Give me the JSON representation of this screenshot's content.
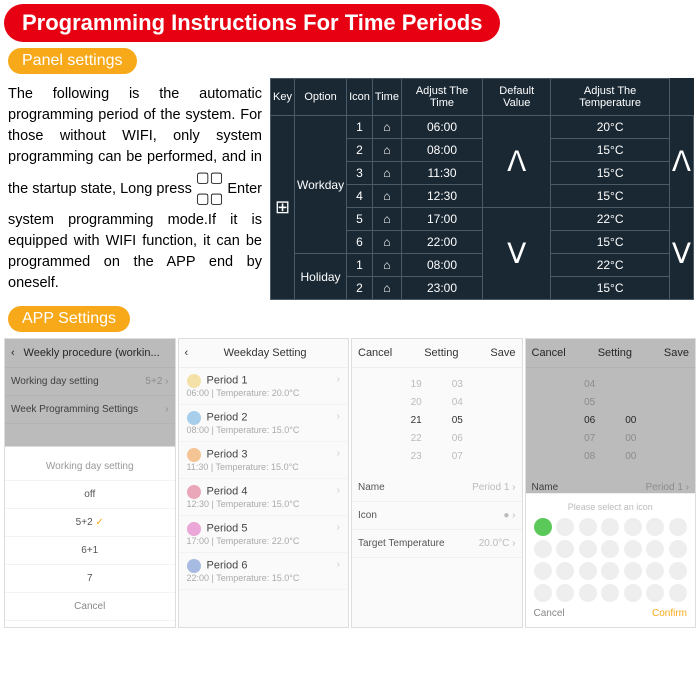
{
  "title": "Programming Instructions For Time Periods",
  "panel_label": "Panel settings",
  "app_label": "APP Settings",
  "desc_a": "The following is the automatic programming period of the system. For those without WIFI, only system programming can be performed, and in the startup state, Long press ",
  "desc_b": " Enter system programming mode.If it is equipped with WIFI function, it can be programmed on the APP end by oneself.",
  "tbl": {
    "h": [
      "Key",
      "Option",
      "Icon",
      "Time",
      "Adjust The Time",
      "Default Value",
      "Adjust The Temperature"
    ],
    "key_icon": "⊞",
    "workday": "Workday",
    "holiday": "Holiday",
    "rows": [
      {
        "n": "1",
        "t": "06:00",
        "v": "20°C"
      },
      {
        "n": "2",
        "t": "08:00",
        "v": "15°C"
      },
      {
        "n": "3",
        "t": "11:30",
        "v": "15°C"
      },
      {
        "n": "4",
        "t": "12:30",
        "v": "15°C"
      },
      {
        "n": "5",
        "t": "17:00",
        "v": "22°C"
      },
      {
        "n": "6",
        "t": "22:00",
        "v": "15°C"
      }
    ],
    "hrows": [
      {
        "n": "1",
        "t": "08:00",
        "v": "22°C"
      },
      {
        "n": "2",
        "t": "23:00",
        "v": "15°C"
      }
    ],
    "up": "ᐱ",
    "down": "ᐯ"
  },
  "p1": {
    "title": "Weekly procedure (workin...",
    "i1": "Working day setting",
    "i1r": "5+2",
    "i2": "Week Programming Settings",
    "sheet_hdr": "Working day setting",
    "opts": [
      "off",
      "5+2",
      "6+1",
      "7"
    ],
    "cancel": "Cancel",
    "sel": "5+2"
  },
  "p2": {
    "back": "‹",
    "title": "Weekday Setting",
    "periods": [
      {
        "t": "Period 1",
        "s": "06:00 | Temperature: 20.0°C",
        "c": "#f0d070"
      },
      {
        "t": "Period 2",
        "s": "08:00 | Temperature: 15.0°C",
        "c": "#70b0e0"
      },
      {
        "t": "Period 3",
        "s": "11:30 | Temperature: 15.0°C",
        "c": "#f0a050"
      },
      {
        "t": "Period 4",
        "s": "12:30 | Temperature: 15.0°C",
        "c": "#e07090"
      },
      {
        "t": "Period 5",
        "s": "17:00 | Temperature: 22.0°C",
        "c": "#e070c0"
      },
      {
        "t": "Period 6",
        "s": "22:00 | Temperature: 15.0°C",
        "c": "#7090d0"
      }
    ]
  },
  "p3": {
    "cancel": "Cancel",
    "title": "Setting",
    "save": "Save",
    "cols": [
      [
        "19",
        "20",
        "21",
        "22",
        "23"
      ],
      [
        "03",
        "04",
        "05",
        "06",
        "07"
      ]
    ],
    "name_l": "Name",
    "name_v": "Period 1",
    "icon_l": "Icon",
    "tt_l": "Target Temperature",
    "tt_v": "20.0°C"
  },
  "p4": {
    "cancel": "Cancel",
    "title": "Setting",
    "save": "Save",
    "name_l": "Name",
    "name_v": "Period 1",
    "icon_l": "Icon",
    "rows": [
      [
        "04",
        ""
      ],
      [
        "05",
        ""
      ],
      [
        "06",
        "00"
      ],
      [
        "07",
        "00"
      ],
      [
        "08",
        "00"
      ]
    ],
    "picker_hdr": "Please select an icon",
    "p_cancel": "Cancel",
    "p_confirm": "Confirm"
  }
}
